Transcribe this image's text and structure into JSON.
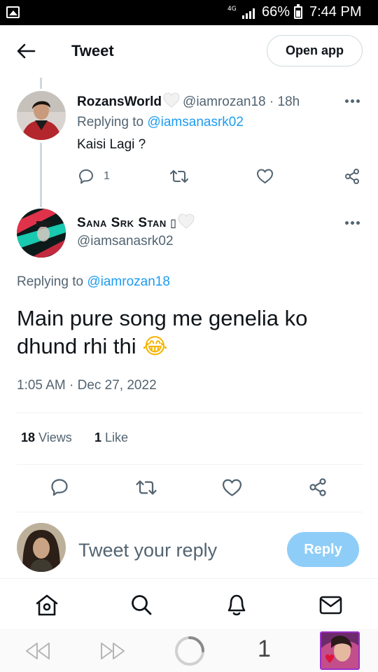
{
  "status_bar": {
    "network": "4G",
    "battery_percent": "66%",
    "time": "7:44 PM"
  },
  "header": {
    "title": "Tweet",
    "open_app_label": "Open app"
  },
  "parent_tweet": {
    "display_name": "RozansWorld",
    "handle": "@iamrozan18",
    "separator": "·",
    "age": "18h",
    "replying_prefix": "Replying to",
    "replying_to": "@iamsanasrk02",
    "text": "Kaisi Lagi ?",
    "reply_count": "1"
  },
  "main_tweet": {
    "display_name": "Sana Srk Stan",
    "name_glyph": "▯",
    "handle": "@iamsanasrk02",
    "replying_prefix": "Replying to",
    "replying_to": "@iamrozan18",
    "text_line1": "Main pure song me genelia ko",
    "text_line2": "dhund rhi thi",
    "emoji": "😂",
    "time": "1:05 AM",
    "date_separator": "·",
    "date": "Dec 27, 2022",
    "views_count": "18",
    "views_label": "Views",
    "likes_count": "1",
    "likes_label": "Like"
  },
  "reply_composer": {
    "placeholder": "Tweet your reply",
    "button_label": "Reply"
  },
  "browser_bar": {
    "tab_count": "1"
  },
  "colors": {
    "accent": "#1d9bf0",
    "reply_button_disabled": "#8ecdf8",
    "muted_text": "#536471",
    "thread_line": "#cfd9de"
  }
}
